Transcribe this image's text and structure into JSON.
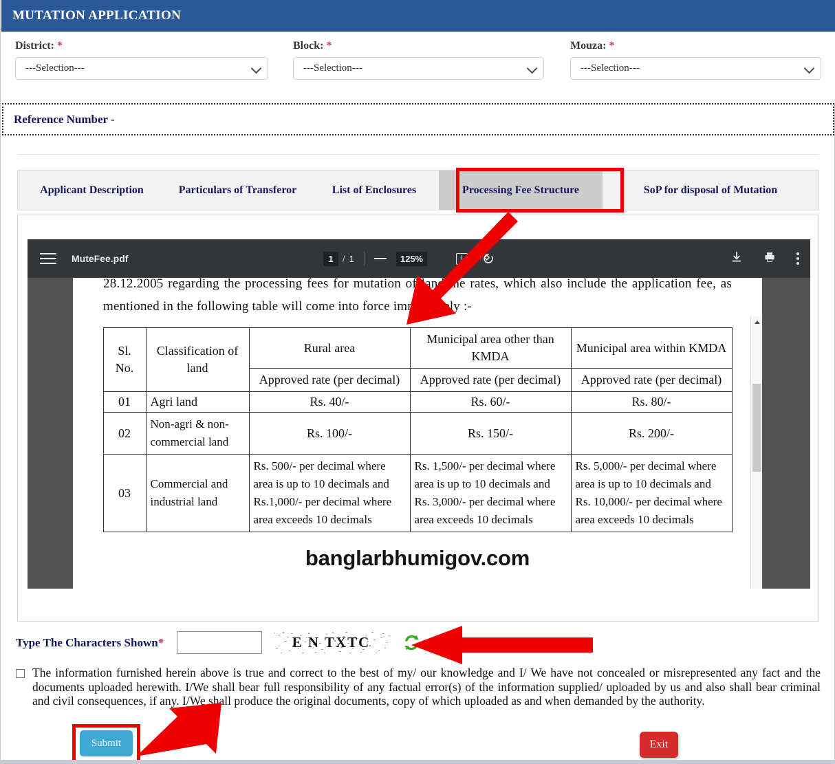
{
  "header": {
    "title": "MUTATION APPLICATION"
  },
  "selectors": {
    "district": {
      "label": "District:",
      "required": "*",
      "value": "---Selection---"
    },
    "block": {
      "label": "Block:",
      "required": "*",
      "value": "---Selection---"
    },
    "mouza": {
      "label": "Mouza:",
      "required": "*",
      "value": "---Selection---"
    }
  },
  "reference": {
    "label": "Reference Number -"
  },
  "tabs": [
    {
      "label": "Applicant Description",
      "active": false
    },
    {
      "label": "Particulars of Transferor",
      "active": false
    },
    {
      "label": "List of Enclosures",
      "active": false
    },
    {
      "label": "Processing Fee Structure",
      "active": true
    },
    {
      "label": "SoP for disposal of Mutation",
      "active": false
    }
  ],
  "pdf_viewer": {
    "filename": "MuteFee.pdf",
    "page_current": "1",
    "page_separator": "/",
    "page_total": "1",
    "zoom_level": "125%",
    "icons": {
      "menu": "hamburger-menu-icon",
      "zoom_out": "minus-icon",
      "fit": "fit-to-page-icon",
      "rotate": "rotate-clockwise-icon",
      "download": "download-icon",
      "print": "print-icon",
      "more": "more-options-icon"
    }
  },
  "document": {
    "paragraph": "28.12.2005 regarding the processing fees for mutation of land the rates, which also include the application fee, as mentioned in the following table will come into force immediately :-",
    "table": {
      "header_row_1": [
        "Sl. No.",
        "Classification of land",
        "Rural area",
        "Municipal area other than KMDA",
        "Municipal area within KMDA"
      ],
      "header_row_2": [
        "Approved rate (per decimal)",
        "Approved rate (per decimal)",
        "Approved rate (per decimal)"
      ],
      "rows": [
        {
          "sl": "01",
          "classification": "Agri land",
          "rural": "Rs. 40/-",
          "municipal_other": "Rs. 60/-",
          "municipal_kmda": "Rs. 80/-"
        },
        {
          "sl": "02",
          "classification": "Non-agri & non-commercial land",
          "rural": "Rs. 100/-",
          "municipal_other": "Rs. 150/-",
          "municipal_kmda": "Rs. 200/-"
        },
        {
          "sl": "03",
          "classification": "Commercial and industrial land",
          "rural": "Rs. 500/- per decimal where area is up to 10 decimals and Rs.1,000/- per decimal where area exceeds 10 decimals",
          "municipal_other": "Rs. 1,500/- per decimal where area is up to 10 decimals and Rs. 3,000/- per decimal where area exceeds 10 decimals",
          "municipal_kmda": "Rs. 5,000/- per decimal where area is up to 10 decimals and Rs. 10,000/- per decimal where area exceeds 10 decimals"
        }
      ]
    },
    "watermark": "banglarbhumigov.com"
  },
  "captcha": {
    "label": "Type The Characters Shown",
    "required": "*",
    "input_value": "",
    "code": "E N TXTC",
    "refresh_icon": "refresh-icon"
  },
  "declaration": {
    "checked": false,
    "text": "The information furnished herein above is true and correct to the best of my/ our knowledge and I/ We have not concealed or misrepresented any fact and the documents uploaded herewith. I/We shall bear full responsibility of any factual error(s) of the information supplied/ uploaded by us and also shall bear criminal and civil consequences, if any. I/We shall produce the original documents, copy of which uploaded as and when demanded by the authority."
  },
  "buttons": {
    "submit": "Submit",
    "exit": "Exit"
  },
  "colors": {
    "header_blue": "#2b5899",
    "tab_text_navy": "#16175e",
    "annotation_red": "#ef0000",
    "submit_blue": "#3fa8d4",
    "exit_red": "#d62b2b"
  }
}
